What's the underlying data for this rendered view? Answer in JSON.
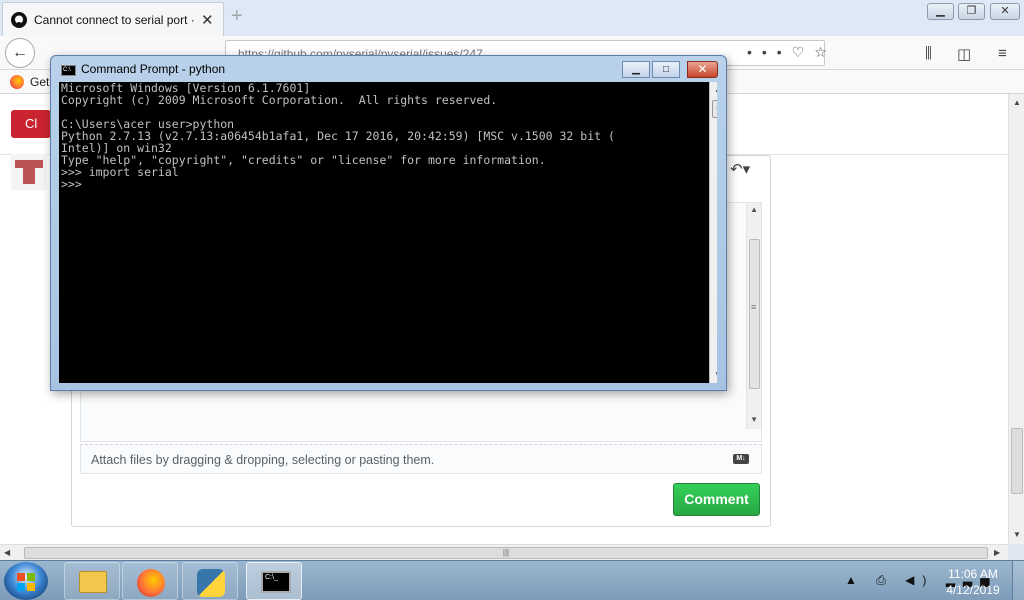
{
  "browser": {
    "tab_title": "Cannot connect to serial port · Issue",
    "tab_close": "✕",
    "new_tab": "+",
    "url": "https://github.com/pyserial/pyserial/issues/247",
    "bookmark_label": "Get",
    "red_button_label": "Cl",
    "win_min": "▁",
    "win_max": "❐",
    "win_close": "✕"
  },
  "issue": {
    "attach_hint": "Attach files by dragging & dropping, selecting or pasting them.",
    "md_badge": "M↓",
    "comment_button": "Comment"
  },
  "cmd": {
    "title": "Command Prompt - python",
    "icon_text": "C:\\",
    "lines": [
      "Microsoft Windows [Version 6.1.7601]",
      "Copyright (c) 2009 Microsoft Corporation.  All rights reserved.",
      "",
      "C:\\Users\\acer user>python",
      "Python 2.7.13 (v2.7.13:a06454b1afa1, Dec 17 2016, 20:42:59) [MSC v.1500 32 bit (",
      "Intel)] on win32",
      "Type \"help\", \"copyright\", \"credits\" or \"license\" for more information.",
      ">>> import serial",
      ">>>"
    ]
  },
  "taskbar": {
    "cmd_icon_text": "C:\\_",
    "tray_icons": "▲ ⎙ ◀) ▂▃▅",
    "time": "11:06 AM",
    "date": "4/12/2019"
  },
  "colors": {
    "comment_green": "#28a745",
    "close_red": "#c8462c",
    "console_bg": "#000000",
    "console_text": "#c0c0c0"
  }
}
